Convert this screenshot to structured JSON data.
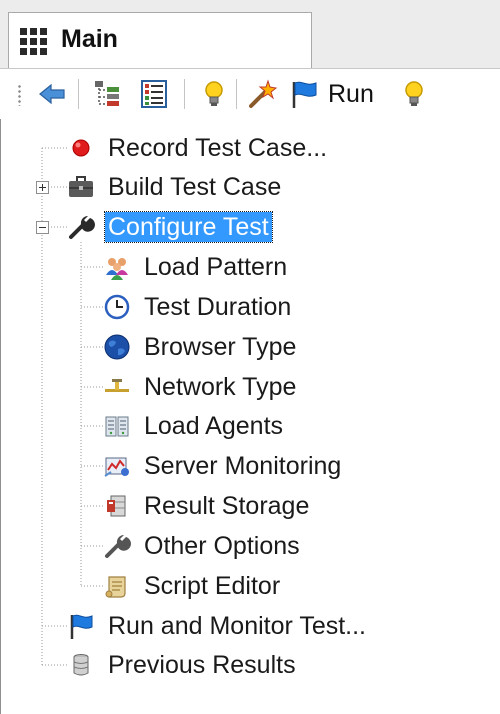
{
  "tab": {
    "label": "Main",
    "icon": "grid-icon"
  },
  "toolbar": {
    "buttons": [
      {
        "name": "back-arrow-icon"
      },
      {
        "name": "tree-view-icon"
      },
      {
        "name": "list-view-icon"
      },
      {
        "name": "lightbulb-icon"
      },
      {
        "name": "magic-wand-icon"
      },
      {
        "name": "run-flag-icon"
      },
      {
        "name": "lightbulb-icon"
      }
    ],
    "run_label": "Run"
  },
  "tree": {
    "items": [
      {
        "label": "Record Test Case...",
        "icon": "record-dot-icon",
        "level": 0
      },
      {
        "label": "Build Test Case",
        "icon": "briefcase-icon",
        "level": 0,
        "expander": "collapsed"
      },
      {
        "label": "Configure Test",
        "icon": "wrench-icon",
        "level": 0,
        "expander": "expanded",
        "selected": true
      },
      {
        "label": "Load Pattern",
        "icon": "users-icon",
        "level": 1
      },
      {
        "label": "Test Duration",
        "icon": "clock-icon",
        "level": 1
      },
      {
        "label": "Browser Type",
        "icon": "globe-icon",
        "level": 1
      },
      {
        "label": "Network Type",
        "icon": "network-icon",
        "level": 1
      },
      {
        "label": "Load Agents",
        "icon": "servers-icon",
        "level": 1
      },
      {
        "label": "Server Monitoring",
        "icon": "server-monitor-icon",
        "level": 1
      },
      {
        "label": "Result Storage",
        "icon": "database-icon",
        "level": 1
      },
      {
        "label": "Other Options",
        "icon": "wrench-icon",
        "level": 1
      },
      {
        "label": "Script Editor",
        "icon": "scroll-icon",
        "level": 1
      },
      {
        "label": "Run and Monitor Test...",
        "icon": "flag-icon",
        "level": 0
      },
      {
        "label": "Previous Results",
        "icon": "database-icon",
        "level": 0
      }
    ]
  },
  "colors": {
    "selection": "#3399ff",
    "tree_line": "#9a9a9a",
    "tab_strip": "#ececec"
  }
}
